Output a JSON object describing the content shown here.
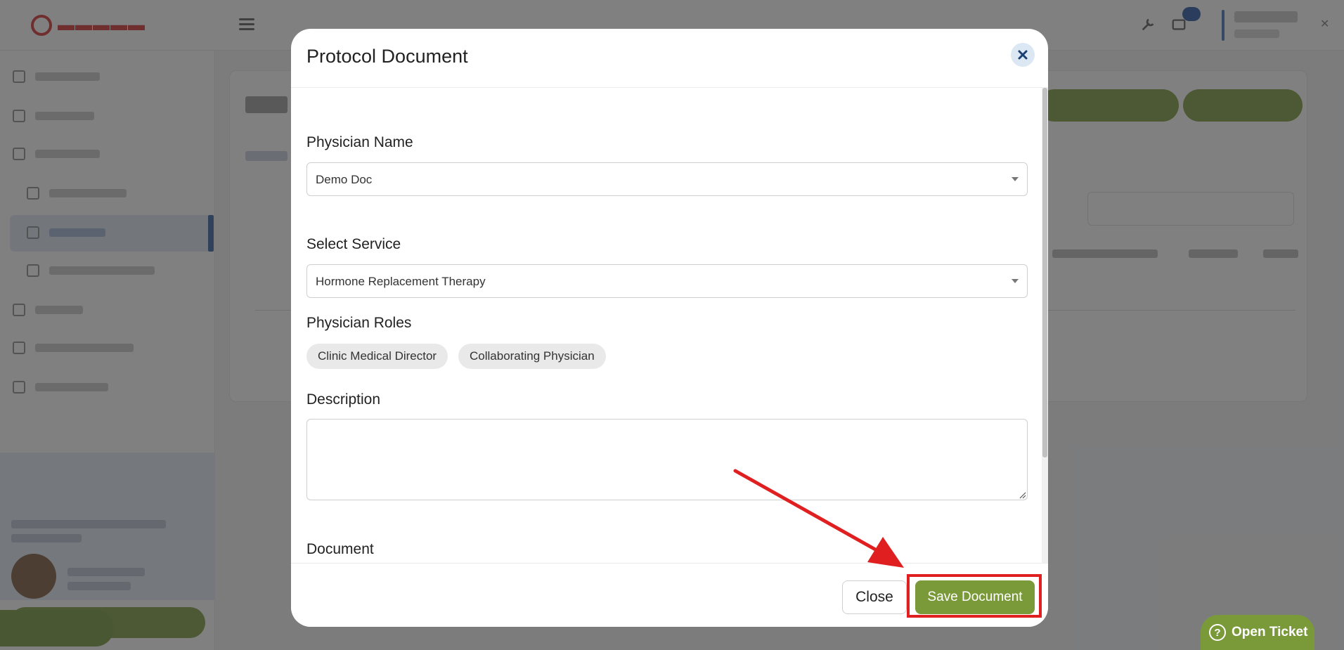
{
  "modal": {
    "title": "Protocol Document",
    "physician_name": {
      "label": "Physician Name",
      "value": "Demo Doc"
    },
    "select_service": {
      "label": "Select Service",
      "value": "Hormone Replacement Therapy"
    },
    "physician_roles": {
      "label": "Physician Roles",
      "roles": [
        "Clinic Medical Director",
        "Collaborating Physician"
      ]
    },
    "description": {
      "label": "Description",
      "value": ""
    },
    "document": {
      "label": "Document"
    },
    "footer": {
      "close_label": "Close",
      "save_label": "Save Document"
    }
  },
  "open_ticket": {
    "label": "Open Ticket",
    "icon": "question-icon"
  },
  "colors": {
    "accent_green": "#7a9a3a",
    "annotation_red": "#e02020",
    "overlay": "rgba(50,50,50,0.62)"
  }
}
